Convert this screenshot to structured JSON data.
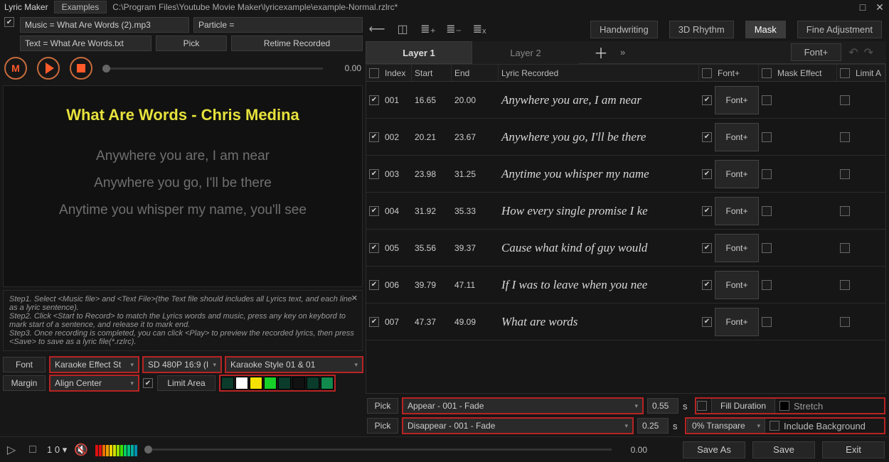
{
  "app_title": "Lyric Maker",
  "examples_btn": "Examples",
  "file_path": "C:\\Program Files\\Youtube Movie Maker\\lyricexample\\example-Normal.rzlrc*",
  "music_field": "Music = What Are Words (2).mp3",
  "particle_field": "Particle =",
  "text_field": "Text = What Are Words.txt",
  "pick_btn": "Pick",
  "retime_btn": "Retime Recorded",
  "transport_time": "0.00",
  "preview": {
    "title": "What Are Words - Chris Medina",
    "line1": "Anywhere you are, I am near",
    "line2": "Anywhere you go, I'll be there",
    "line3": "Anytime you whisper my name, you'll see"
  },
  "tips": {
    "s1": "Step1. Select <Music file> and <Text File>(the Text file should includes all Lyrics text, and each line as a lyric sentence).",
    "s2": "Step2. Click <Start to Record> to match the Lyrics words and music, press any key on keybord to mark start of a sentence, and release it to mark end.",
    "s3": "Step3. Once recording is completed, you can click <Play> to preview the recorded lyrics, then press <Save> to save as a lyric file(*.rzlrc)."
  },
  "opt": {
    "font_lbl": "Font",
    "karaoke_effect": "Karaoke Effect St",
    "resolution": "SD 480P 16:9 (I",
    "karaoke_style": "Karaoke Style 01 & 01",
    "margin_lbl": "Margin",
    "align": "Align Center",
    "limit_lbl": "Limit Area"
  },
  "palette": [
    "#0a3b2b",
    "#ffffff",
    "#f4e300",
    "#17d028",
    "#0a3b2b",
    "#111111",
    "#0a3b2b",
    "#118a4e"
  ],
  "right": {
    "handwriting": "Handwriting",
    "rhythm": "3D Rhythm",
    "mask": "Mask",
    "fine": "Fine Adjustment",
    "layer1": "Layer 1",
    "layer2": "Layer 2",
    "fontplus": "Font+",
    "hdr_index": "Index",
    "hdr_start": "Start",
    "hdr_end": "End",
    "hdr_lyric": "Lyric Recorded",
    "hdr_font": "Font+",
    "hdr_mask": "Mask Effect",
    "hdr_limit": "Limit A"
  },
  "rows": [
    {
      "i": "001",
      "s": "16.65",
      "e": "20.00",
      "t": "Anywhere you are, I am near"
    },
    {
      "i": "002",
      "s": "20.21",
      "e": "23.67",
      "t": "Anywhere you go, I'll be there"
    },
    {
      "i": "003",
      "s": "23.98",
      "e": "31.25",
      "t": "Anytime you whisper my name"
    },
    {
      "i": "004",
      "s": "31.92",
      "e": "35.33",
      "t": "How every single promise I ke"
    },
    {
      "i": "005",
      "s": "35.56",
      "e": "39.37",
      "t": "Cause what kind of guy would"
    },
    {
      "i": "006",
      "s": "39.79",
      "e": "47.11",
      "t": "If I was to leave when you nee"
    },
    {
      "i": "007",
      "s": "47.37",
      "e": "49.09",
      "t": "What are words"
    }
  ],
  "bot": {
    "pick": "Pick",
    "appear": "Appear - 001 - Fade",
    "appear_dur": "0.55",
    "appear_unit": "s",
    "disappear": "Disappear - 001 - Fade",
    "dis_dur": "0.25",
    "dis_unit": "s",
    "fill": "Fill Duration",
    "stretch": "Stretch",
    "transparent": "0% Transpare",
    "include_bg": "Include Background"
  },
  "footer": {
    "loop": "1",
    "zero": "0",
    "time": "0.00",
    "save_as": "Save As",
    "save": "Save",
    "exit": "Exit"
  }
}
